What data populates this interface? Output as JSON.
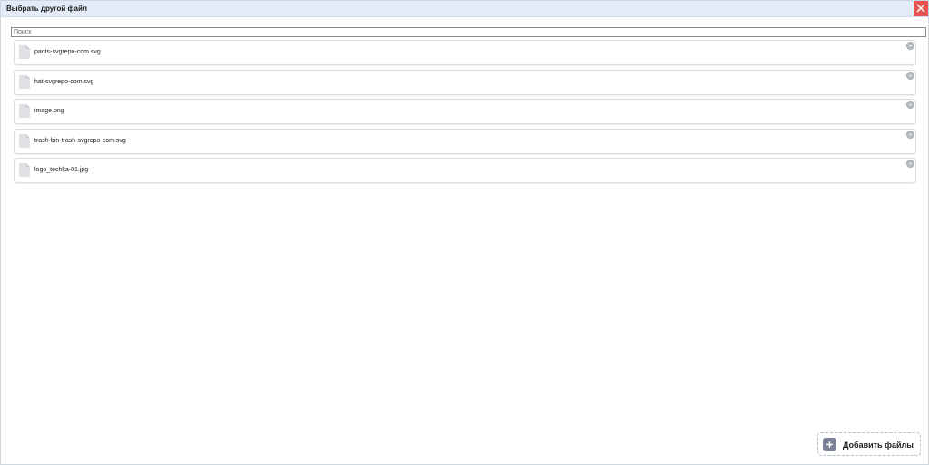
{
  "dialog": {
    "title": "Выбрать другой файл",
    "close_icon": "close-icon"
  },
  "search": {
    "placeholder": "Поиск",
    "value": ""
  },
  "files": [
    {
      "name": "pants-svgrepo-com.svg",
      "icon": "file-icon"
    },
    {
      "name": "hat-svgrepo-com.svg",
      "icon": "file-icon"
    },
    {
      "name": "image.png",
      "icon": "file-icon"
    },
    {
      "name": "trash-bin-trash-svgrepo-com.svg",
      "icon": "file-icon"
    },
    {
      "name": "logo_techka-01.jpg",
      "icon": "file-icon"
    }
  ],
  "add_button": {
    "label": "Добавить файлы",
    "icon": "plus-icon"
  },
  "colors": {
    "titlebar": "#e3ebf8",
    "close": "#e85454",
    "add_icon": "#7b8296"
  }
}
